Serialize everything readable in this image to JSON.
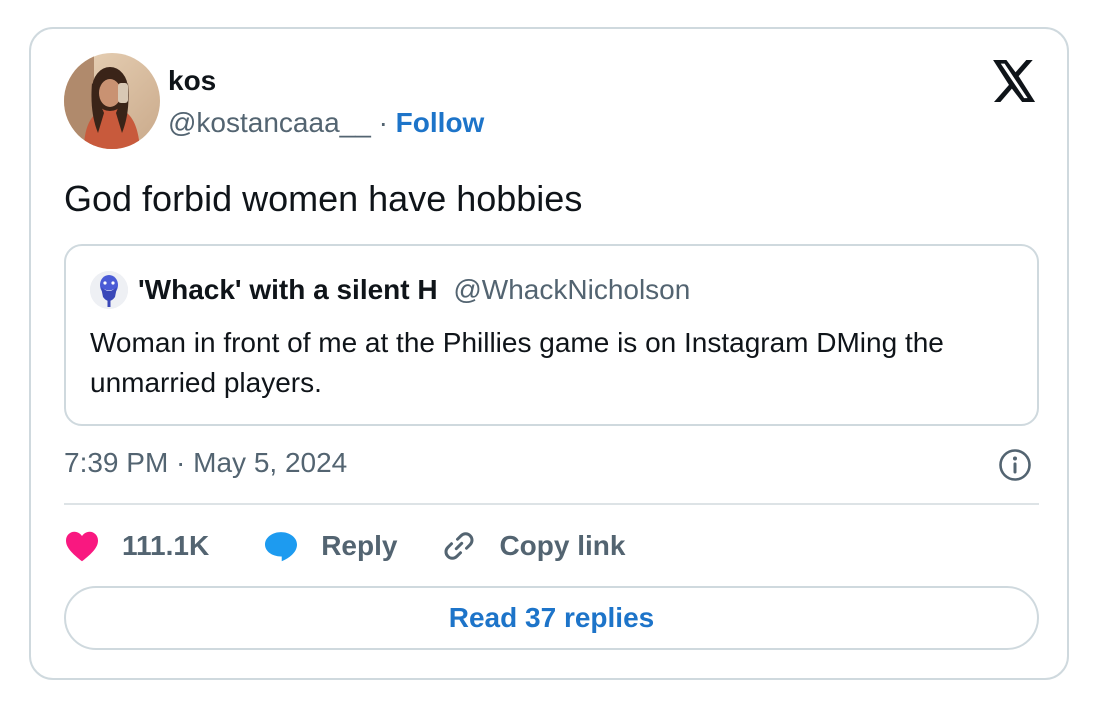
{
  "tweet": {
    "author": {
      "display_name": "kos",
      "handle": "@kostancaaa__"
    },
    "separator": "·",
    "follow_label": "Follow",
    "text": "God forbid women have hobbies",
    "timestamp": "7:39 PM · May 5, 2024"
  },
  "quoted_tweet": {
    "display_name": "'Whack' with a silent H",
    "handle": "@WhackNicholson",
    "text": "Woman in front of me at the Phillies game is on Instagram DMing the unmarried players."
  },
  "actions": {
    "like_count": "111.1K",
    "reply_label": "Reply",
    "copy_link_label": "Copy link"
  },
  "footer": {
    "read_replies_label": "Read 37 replies"
  },
  "colors": {
    "link_blue": "#1d74c9",
    "heart_pink": "#f91880",
    "reply_blue": "#1d9bf0",
    "muted_text": "#536471",
    "border": "#cfd9de"
  },
  "icons": {
    "brand": "x-logo-icon",
    "info": "info-icon",
    "like": "heart-icon",
    "reply": "speech-bubble-icon",
    "copy": "link-icon"
  }
}
